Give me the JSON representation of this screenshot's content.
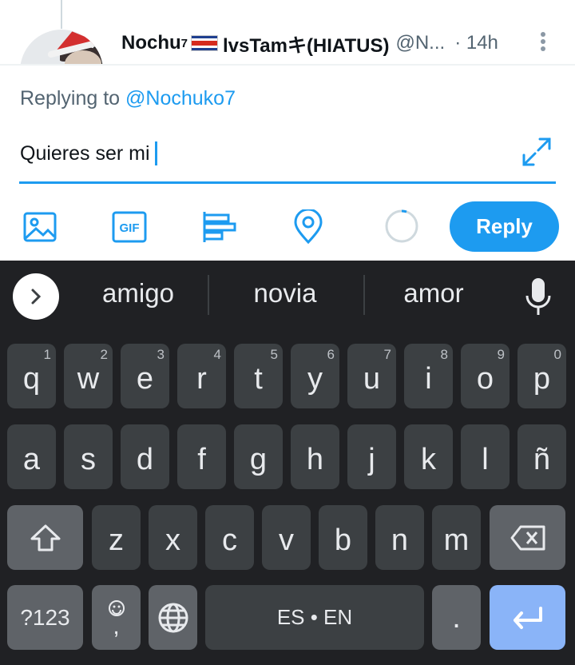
{
  "tweet": {
    "display_name_part1": "Nochu",
    "display_name_sup": "7",
    "display_name_part2": "lvsTamキ(HIATUS)",
    "handle": "@N...",
    "time": "· 14h"
  },
  "composer": {
    "replying_prefix": "Replying to",
    "replying_to": "@Nochuko7",
    "text": "Quieres ser mi",
    "reply_button": "Reply"
  },
  "toolbar": {
    "icons": [
      "image-icon",
      "gif-icon",
      "poll-icon",
      "location-icon"
    ],
    "gif_label": "GIF"
  },
  "keyboard": {
    "suggestions": [
      "amigo",
      "novia",
      "amor"
    ],
    "row1": [
      {
        "char": "q",
        "digit": "1"
      },
      {
        "char": "w",
        "digit": "2"
      },
      {
        "char": "e",
        "digit": "3"
      },
      {
        "char": "r",
        "digit": "4"
      },
      {
        "char": "t",
        "digit": "5"
      },
      {
        "char": "y",
        "digit": "6"
      },
      {
        "char": "u",
        "digit": "7"
      },
      {
        "char": "i",
        "digit": "8"
      },
      {
        "char": "o",
        "digit": "9"
      },
      {
        "char": "p",
        "digit": "0"
      }
    ],
    "row2": [
      "a",
      "s",
      "d",
      "f",
      "g",
      "h",
      "j",
      "k",
      "l",
      "ñ"
    ],
    "row3": [
      "z",
      "x",
      "c",
      "v",
      "b",
      "n",
      "m"
    ],
    "symbols_key": "?123",
    "comma_key": ",",
    "space_label": "ES • EN",
    "period_key": "."
  },
  "colors": {
    "accent": "#1d9bf0",
    "keyboard_bg": "#202124",
    "key_bg": "#3c4043",
    "fn_key_bg": "#5f6368",
    "enter_key_bg": "#8ab4f8"
  }
}
